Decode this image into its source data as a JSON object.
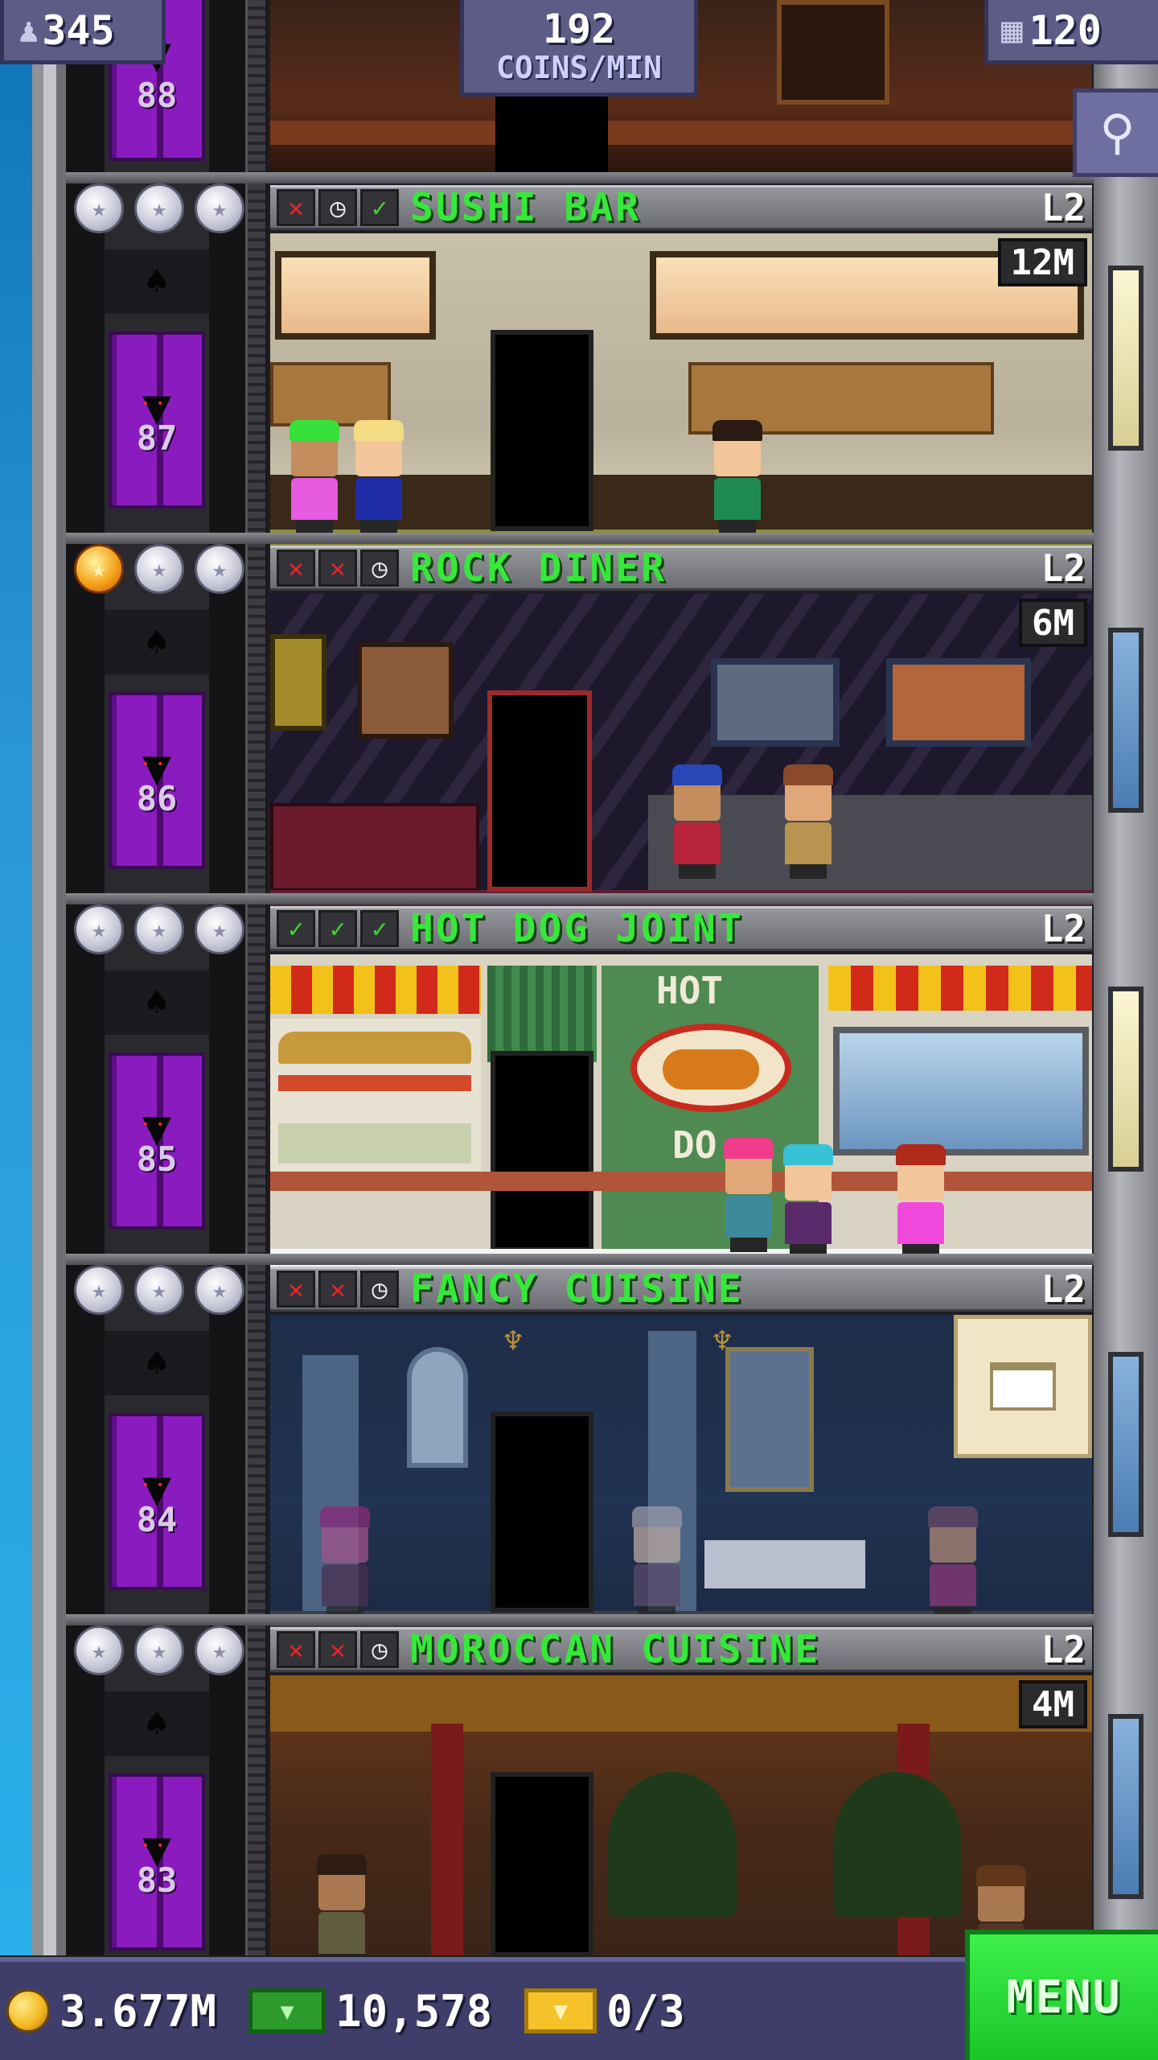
{
  "hud": {
    "population": "345",
    "coins_rate": "192",
    "coins_rate_unit": "COINS/MIN",
    "floors": "120",
    "population_icon": "person-icon",
    "floors_icon": "building-icon",
    "search_icon": "magnifier-icon"
  },
  "top_floor_partial": {
    "elevator_number": "88"
  },
  "floors": [
    {
      "name": "SUSHI BAR",
      "level": "L2",
      "timer": "12M",
      "elevator_number": "87",
      "stars": [
        "silver",
        "silver",
        "silver"
      ],
      "status": [
        "x",
        "clock",
        "check"
      ]
    },
    {
      "name": "ROCK DINER",
      "level": "L2",
      "timer": "6M",
      "elevator_number": "86",
      "stars": [
        "gold",
        "silver",
        "silver"
      ],
      "status": [
        "x",
        "x",
        "clock"
      ]
    },
    {
      "name": "HOT DOG JOINT",
      "level": "L2",
      "timer": "",
      "elevator_number": "85",
      "stars": [
        "silver",
        "silver",
        "silver"
      ],
      "status": [
        "check",
        "check",
        "check"
      ],
      "sign_top": "HOT",
      "sign_bottom": "DO"
    },
    {
      "name": "FANCY CUISINE",
      "level": "L2",
      "timer": "",
      "elevator_number": "84",
      "stars": [
        "silver",
        "silver",
        "silver"
      ],
      "status": [
        "x",
        "x",
        "clock"
      ]
    },
    {
      "name": "MOROCCAN CUISINE",
      "level": "L2",
      "timer": "4M",
      "elevator_number": "83",
      "stars": [
        "silver",
        "silver",
        "silver"
      ],
      "status": [
        "x",
        "x",
        "clock"
      ]
    }
  ],
  "bottom": {
    "coins": "3.677M",
    "bux": "10,578",
    "tickets": "0/3",
    "menu_label": "MENU"
  },
  "colors": {
    "floor_name": "#36e83a",
    "elevator": "#8a1cbf",
    "menu": "#2bdc3a",
    "hud": "#5d5c86"
  }
}
